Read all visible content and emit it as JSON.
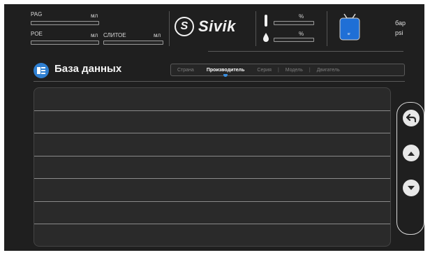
{
  "header": {
    "meters": {
      "pag": {
        "label": "PAG",
        "unit": "мл"
      },
      "poe": {
        "label": "POE",
        "unit": "мл"
      },
      "waste_oil": {
        "label": "СЛИТОЕ",
        "unit": "мл"
      }
    },
    "logo_text": "Sivik",
    "gauges": {
      "temp_unit": "%",
      "humidity_unit": "%"
    },
    "tank_label": "кг",
    "pressure_units": [
      "бар",
      "psi"
    ]
  },
  "page": {
    "title": "База данных",
    "tabs": [
      "Страна",
      "Производитель",
      "Серия",
      "Модель",
      "Двигатель"
    ],
    "active_tab_index": 1
  },
  "list": {
    "rows": [
      "",
      "",
      "",
      "",
      "",
      "",
      ""
    ]
  },
  "side_controls": {
    "buttons": [
      "back-icon",
      "arrow-up-icon",
      "arrow-down-icon"
    ]
  },
  "colors": {
    "accent": "#3a8fe0",
    "background": "#1f1f1f",
    "panel": "#2a2a2a"
  }
}
